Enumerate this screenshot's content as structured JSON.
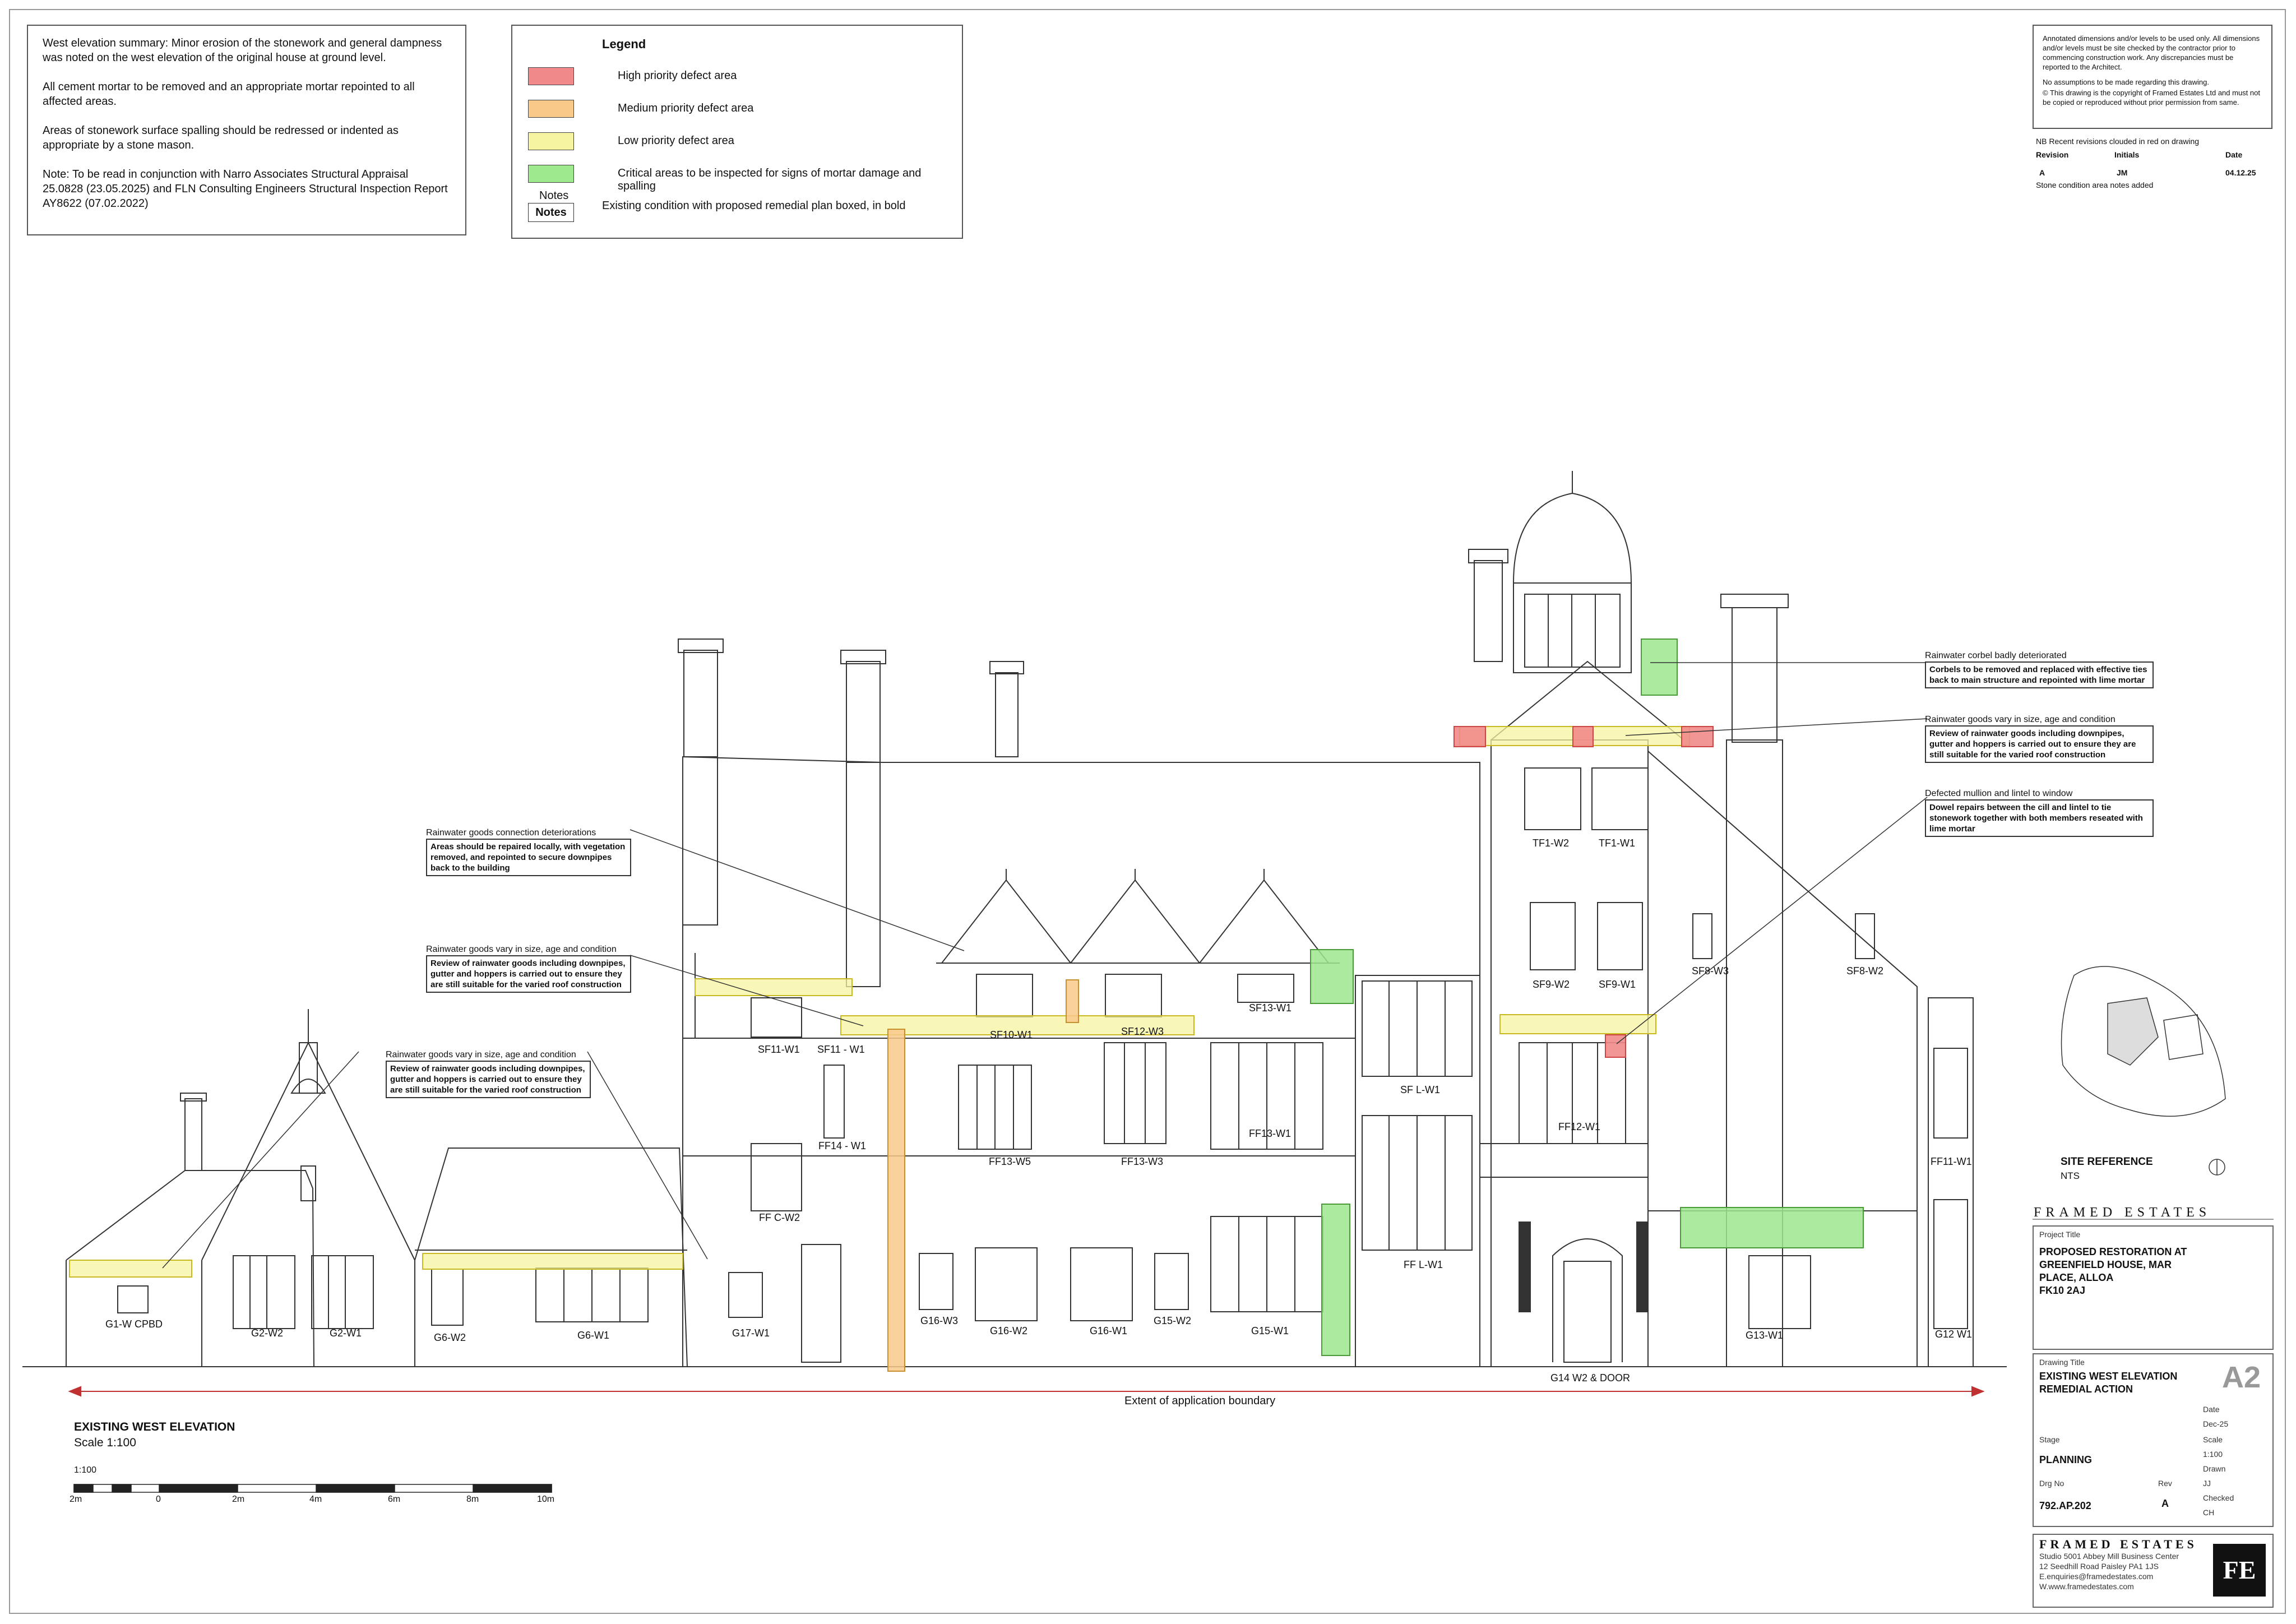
{
  "summary": {
    "para1": "West elevation summary: Minor erosion of the stonework and general dampness was noted on the west elevation of the original house at ground level.",
    "para2": "All cement mortar to be removed and an appropriate mortar repointed to all affected areas.",
    "para3": "Areas of stonework surface spalling should be redressed or indented as appropriate by a stone mason.",
    "para4": "Note: To be read in conjunction with Narro Associates Structural Appraisal 25.0828 (23.05.2025) and FLN Consulting Engineers Structural Inspection Report AY8622 (07.02.2022)"
  },
  "legend": {
    "title": "Legend",
    "items": [
      {
        "label": "High priority defect area",
        "color": "#f08a8a"
      },
      {
        "label": "Medium priority defect area",
        "color": "#f9c98a"
      },
      {
        "label": "Low priority defect area",
        "color": "#f6f4a0"
      },
      {
        "label": "Critical areas to be inspected for signs of mortar damage and spalling",
        "color": "#9ee88e"
      }
    ],
    "notes_small": "Notes",
    "notes_box": "Notes",
    "notes_desc": "Existing condition with proposed remedial plan boxed, in bold"
  },
  "disclaimer": {
    "p1": "Annotated dimensions and/or levels to be used only. All dimensions and/or levels must be site checked by the contractor prior to commencing construction work. Any discrepancies must be reported to the Architect.",
    "p2": "No assumptions to be made regarding this drawing.",
    "p3": "© This drawing is the copyright of Framed Estates Ltd and must not be copied or reproduced without prior permission from same."
  },
  "revisions": {
    "note": "NB Recent revisions clouded in red on drawing",
    "h_revision": "Revision",
    "h_initials": "Initials",
    "h_date": "Date",
    "rev": "A",
    "initials": "JM",
    "date": "04.12.25",
    "desc": "Stone condition area notes added"
  },
  "callouts": {
    "c1_title": "Rainwater goods connection deteriorations",
    "c1_body": "Areas should be repaired locally, with vegetation removed, and repointed to secure downpipes back to the building",
    "c2_title": "Rainwater goods vary in size, age and condition",
    "c2_body": "Review of rainwater goods including downpipes, gutter and hoppers is carried out to ensure they are still suitable for the varied roof construction",
    "c3_title": "Rainwater goods vary in size, age and condition",
    "c3_body": "Review of rainwater goods including downpipes, gutter and hoppers is carried out to ensure they are still suitable for the varied roof construction",
    "r1_title": "Rainwater corbel badly deteriorated",
    "r1_body": "Corbels to be removed and replaced with effective ties back to main structure and repointed with lime mortar",
    "r2_title": "Rainwater goods vary in size, age and condition",
    "r2_body": "Review of rainwater goods including downpipes, gutter and hoppers is carried out to ensure they are still suitable for the varied roof construction",
    "r3_title": "Defected mullion and lintel to window",
    "r3_body": "Dowel repairs between the cill and lintel to tie stonework together with both members reseated with lime mortar"
  },
  "window_labels": {
    "g1": "G1-W CPBD",
    "g2w2": "G2-W2",
    "g2w1": "G2-W1",
    "g6w2": "G6-W2",
    "g6w1": "G6-W1",
    "g17": "G17-W1",
    "ffcw2": "FF C-W2",
    "sf11w1": "SF11-W1",
    "sf11dash": "SF11 - W1",
    "ff14": "FF14 - W1",
    "g16w3": "G16-W3",
    "g16w2": "G16-W2",
    "g16w1": "G16-W1",
    "g15w2": "G15-W2",
    "g15w1": "G15-W1",
    "ff13w5": "FF13-W5",
    "ff13w3": "FF13-W3",
    "sf10w1": "SF10-W1",
    "sf12w3": "SF12-W3",
    "sf13w1": "SF13-W1",
    "ff13w1": "FF13-W1",
    "sflw1": "SF L-W1",
    "fflw1": "FF L-W1",
    "tf1w2": "TF1-W2",
    "tf1w1": "TF1-W1",
    "sf9w2": "SF9-W2",
    "sf9w1": "SF9-W1",
    "sf8w3": "SF8-W3",
    "sf8w2": "SF8-W2",
    "ff12w1": "FF12-W1",
    "ff11w1": "FF11-W1",
    "g13w1": "G13-W1",
    "g12w1": "G12 W1",
    "g14": "G14 W2 & DOOR"
  },
  "boundary_label": "Extent of application boundary",
  "elevation": {
    "title": "EXISTING WEST ELEVATION",
    "scale": "Scale 1:100",
    "bar_ratio": "1:100",
    "ticks": [
      "2m",
      "0",
      "2m",
      "4m",
      "6m",
      "8m",
      "10m"
    ]
  },
  "site": {
    "title": "SITE REFERENCE",
    "sub": "NTS"
  },
  "titleblock": {
    "brand": "FRAMED ESTATES",
    "project_title_label": "Project Title",
    "project_title": "PROPOSED RESTORATION AT GREENFIELD HOUSE, MAR PLACE, ALLOA",
    "postcode": "FK10 2AJ",
    "drawing_title_label": "Drawing Title",
    "drawing_title": "EXISTING WEST ELEVATION REMEDIAL ACTION",
    "size": "A2",
    "date_label": "Date",
    "date": "Dec-25",
    "scale_label": "Scale",
    "scale": "1:100",
    "drawn_label": "Drawn",
    "drawn": "JJ",
    "checked_label": "Checked",
    "checked": "CH",
    "stage_label": "Stage",
    "stage": "PLANNING",
    "drg_label": "Drg No",
    "drg": "792.AP.202",
    "rev_label": "Rev",
    "rev": "A",
    "address1": "Studio 5001 Abbey Mill Business Center",
    "address2": "12 Seedhill Road Paisley PA1 1JS",
    "email": "E.enquiries@framedestates.com",
    "web": "W.www.framedestates.com",
    "logo": "FE"
  }
}
